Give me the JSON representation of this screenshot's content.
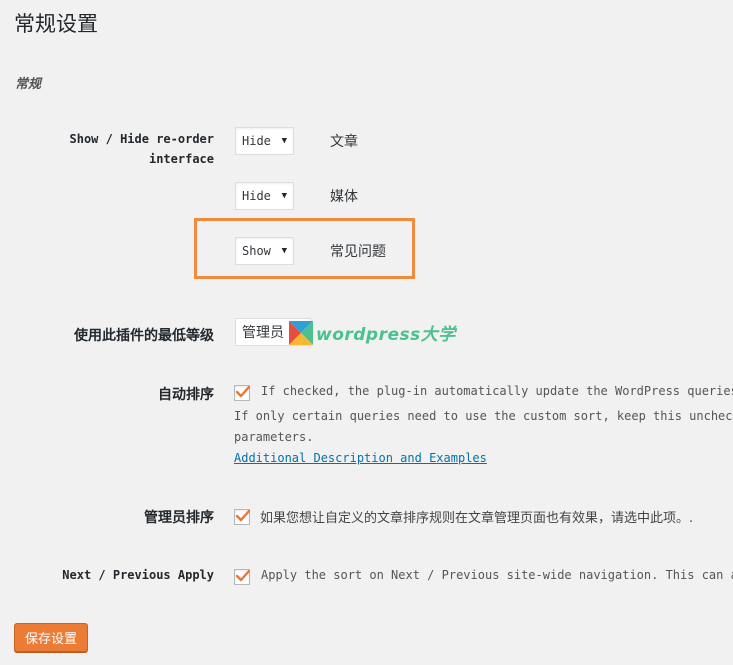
{
  "page_title": "常规设置",
  "section_title": "常规",
  "reorder": {
    "label_line1": "Show / Hide re-order",
    "label_line2": "interface",
    "rows": [
      {
        "value": "Hide",
        "type": "文章"
      },
      {
        "value": "Hide",
        "type": "媒体"
      },
      {
        "value": "Show",
        "type": "常见问题"
      }
    ]
  },
  "min_level": {
    "label": "使用此插件的最低等级",
    "value": "管理员"
  },
  "watermark": {
    "text": "wordpress大学"
  },
  "auto_sort": {
    "label": "自动排序",
    "checked": true,
    "line1": "If checked, the plug-in automatically update the WordPress queries t",
    "line2": "If only certain queries need to use the custom sort, keep this unchecked",
    "line3": "parameters.",
    "link": "Additional Description and Examples"
  },
  "admin_sort": {
    "label": "管理员排序",
    "checked": true,
    "text": "如果您想让自定义的文章排序规则在文章管理页面也有效果，请选中此项。."
  },
  "next_prev": {
    "label": "Next / Previous Apply",
    "checked": true,
    "text": "Apply the sort on Next / Previous site-wide navigation. This can als"
  },
  "save_label": "保存设置",
  "colors": {
    "accent_orange": "#ec7c35",
    "highlight_box": "#f08a3c",
    "link_blue": "#0073aa",
    "watermark_green": "#4cc08f"
  }
}
